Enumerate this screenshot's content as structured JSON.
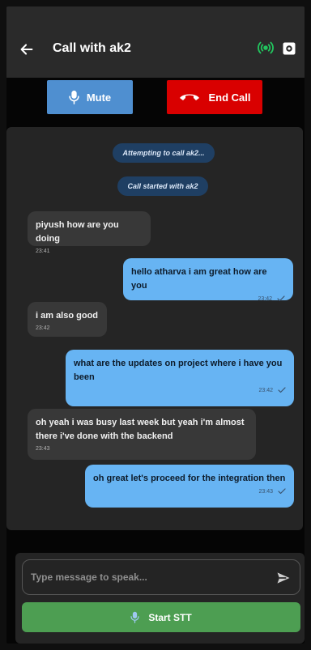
{
  "header": {
    "title": "Call with ak2",
    "back_icon": "arrow-left-icon",
    "status_icon": "signal-icon",
    "settings_icon": "gear-icon"
  },
  "controls": {
    "mute_label": "Mute",
    "end_call_label": "End Call",
    "mute_icon": "microphone-icon",
    "end_call_icon": "phone-hangup-icon"
  },
  "chat": {
    "system_messages": [
      "Attempting to call ak2...",
      "Call started with ak2"
    ],
    "messages": [
      {
        "side": "received",
        "text": "piyush how are you doing",
        "time": "23:41"
      },
      {
        "side": "sent",
        "text": "hello atharva i am great how are you",
        "time": "23:42"
      },
      {
        "side": "received",
        "text": "i am also good",
        "time": "23:42"
      },
      {
        "side": "sent",
        "text": "what are the updates on project where i have you been",
        "time": "23:42"
      },
      {
        "side": "received",
        "text": "oh yeah i was busy last week but yeah i'm almost there i've done with the backend",
        "time": "23:43"
      },
      {
        "side": "sent",
        "text": "oh great let's proceed for the integration then",
        "time": "23:43"
      }
    ]
  },
  "composer": {
    "placeholder": "Type message to speak...",
    "stt_label": "Start STT",
    "send_icon": "send-icon"
  },
  "colors": {
    "accent_blue": "#67b4f3",
    "mute_blue": "#4f8fd0",
    "end_red": "#d90000",
    "stt_green": "#4d9e52",
    "signal_green": "#22c55e"
  }
}
